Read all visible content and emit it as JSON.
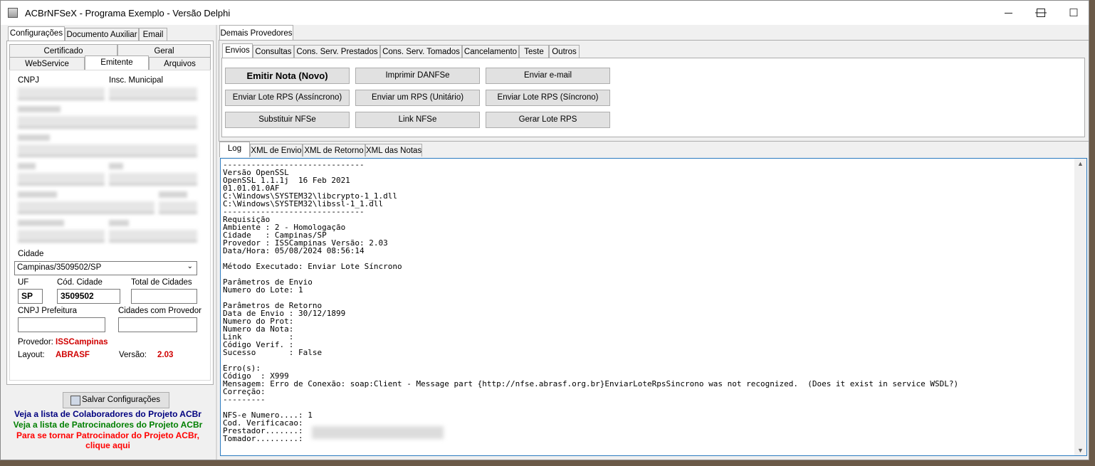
{
  "window": {
    "title": "ACBrNFSeX - Programa Exemplo - Versão Delphi",
    "minimize": "—",
    "maximize": "☐",
    "close": "✕"
  },
  "left": {
    "tabs": [
      "Configurações",
      "Documento Auxiliar",
      "Email"
    ],
    "subtabs_row1": [
      "Certificado",
      "Geral"
    ],
    "subtabs_row2": [
      "WebService",
      "Emitente",
      "Arquivos"
    ],
    "labels": {
      "cnpj": "CNPJ",
      "insc_municipal": "Insc. Municipal",
      "cidade": "Cidade",
      "uf": "UF",
      "cod_cidade": "Cód. Cidade",
      "total_cidades": "Total de Cidades",
      "cnpj_prefeitura": "CNPJ Prefeitura",
      "cidades_provedor": "Cidades com Provedor",
      "provedor": "Provedor:",
      "layout": "Layout:",
      "versao": "Versão:"
    },
    "values": {
      "cidade": "Campinas/3509502/SP",
      "uf": "SP",
      "cod_cidade": "3509502",
      "total_cidades": "",
      "cnpj_prefeitura": "",
      "cidades_provedor": "",
      "provedor": "ISSCampinas",
      "layout": "ABRASF",
      "versao": "2.03"
    },
    "save_button": "Salvar Configurações",
    "links": {
      "colaboradores": "Veja a lista de Colaboradores do Projeto ACBr",
      "patrocinadores": "Veja a lista de Patrocinadores do Projeto ACBr",
      "tornar_1": "Para se tornar Patrocinador do Projeto ACBr,",
      "tornar_2": "clique aqui"
    },
    "link_colors": {
      "colaboradores": "#00007f",
      "patrocinadores": "#007f00",
      "tornar": "#ff0000"
    }
  },
  "right": {
    "top_tab": "Demais Provedores",
    "tabs": [
      "Envios",
      "Consultas",
      "Cons. Serv. Prestados",
      "Cons. Serv. Tomados",
      "Cancelamento",
      "Teste",
      "Outros"
    ],
    "buttons": [
      "Emitir Nota (Novo)",
      "Imprimir DANFSe",
      "Enviar e-mail",
      "Enviar Lote RPS (Assíncrono)",
      "Enviar um RPS (Unitário)",
      "Enviar Lote RPS (Síncrono)",
      "Substituir NFSe",
      "Link NFSe",
      "Gerar Lote RPS"
    ],
    "log_tabs": [
      "Log",
      "XML de Envio",
      "XML de Retorno",
      "XML das Notas"
    ],
    "log_text": "------------------------------\nVersão OpenSSL\nOpenSSL 1.1.1j  16 Feb 2021\n01.01.01.0AF\nC:\\Windows\\SYSTEM32\\libcrypto-1_1.dll\nC:\\Windows\\SYSTEM32\\libssl-1_1.dll\n------------------------------\nRequisição\nAmbiente : 2 - Homologação\nCidade   : Campinas/SP\nProvedor : ISSCampinas Versão: 2.03\nData/Hora: 05/08/2024 08:56:14\n\nMétodo Executado: Enviar Lote Síncrono\n\nParâmetros de Envio\nNumero do Lote: 1\n\nParâmetros de Retorno\nData de Envio : 30/12/1899\nNumero do Prot:\nNumero da Nota:\nLink          :\nCódigo Verif. :\nSucesso       : False\n\nErro(s):\nCódigo  : X999\nMensagem: Erro de Conexão: soap:Client - Message part {http://nfse.abrasf.org.br}EnviarLoteRpsSincrono was not recognized.  (Does it exist in service WSDL?)\nCorreção:\n---------\n\nNFS-e Numero....: 1\nCod. Verificacao:\nPrestador.......:\nTomador.........:"
  }
}
